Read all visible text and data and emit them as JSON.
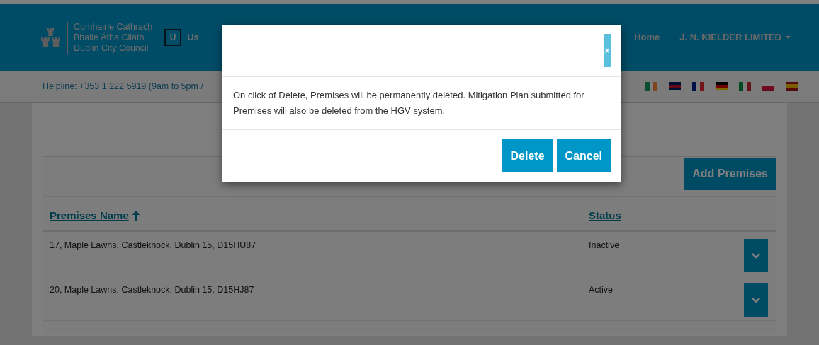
{
  "header": {
    "logo_lines": [
      "Comhairle Cathrach",
      "Bhaile Átha Cliath",
      "Dublin City Council"
    ],
    "user_initial": "U",
    "user_label": "Us",
    "nav": [
      {
        "label": "Home",
        "kind": "link"
      },
      {
        "label": "J. N. KIELDER LIMITED",
        "kind": "dropdown"
      }
    ]
  },
  "helpline": "Helpline: +353 1 222 5919 (9am to 5pm /",
  "premises": {
    "add_button": "Add Premises",
    "columns": [
      {
        "label": "Premises Name",
        "sorted": true
      },
      {
        "label": "Status",
        "sorted": false
      }
    ],
    "rows": [
      {
        "name": "17, Maple Lawns, Castleknock, Dublin 15, D15HU87",
        "status": "Inactive"
      },
      {
        "name": "20, Maple Lawns, Castleknock, Dublin 15, D15HJ87",
        "status": "Active"
      }
    ]
  },
  "dialog": {
    "close": "×",
    "message": "On click of Delete, Premises will be permanently deleted. Mitigation Plan submitted for Premises will also be deleted from the HGV system.",
    "buttons": [
      "Delete",
      "Cancel"
    ]
  }
}
